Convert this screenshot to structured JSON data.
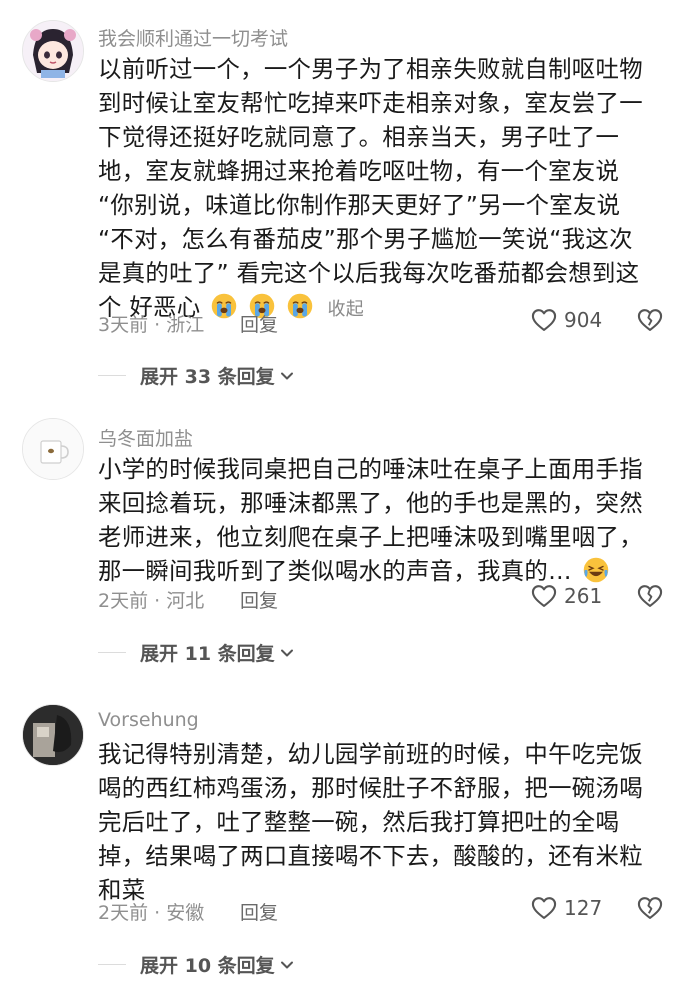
{
  "comments": [
    {
      "username": "我会顺利通过一切考试",
      "lines": [
        "以前听过一个，一个男子为了相亲失败就自制呕吐物",
        "到时候让室友帮忙吃掉来吓走相亲对象，室友尝了一",
        "下觉得还挺好吃就同意了。相亲当天，男子吐了一",
        "地，室友就蜂拥过来抢着吃呕吐物，有一个室友说",
        "“你别说，味道比你制作那天更好了”另一个室友说",
        "“不对，怎么有番茄皮”那个男子尴尬一笑说“我这次",
        "是真的吐了” 看完这个以后我每次吃番茄都会想到这",
        "个 好恶心"
      ],
      "emoji": [
        "loudly-crying-emoji",
        "loudly-crying-emoji",
        "loudly-crying-emoji"
      ],
      "fold_label": "收起",
      "time_location": "3天前 · 浙江",
      "reply_label": "回复",
      "likes": "904",
      "expand_label": "展开 33 条回复"
    },
    {
      "username": "乌冬面加盐",
      "lines": [
        "小学的时候我同桌把自己的唾沫吐在桌子上面用手指",
        "来回捻着玩，那唾沫都黑了，他的手也是黑的，突然",
        "老师进来，他立刻爬在桌子上把唾沫吸到嘴里咽了，",
        "那一瞬间我听到了类似喝水的声音，我真的…"
      ],
      "emoji": [
        "tears-of-joy-emoji"
      ],
      "time_location": "2天前 · 河北",
      "reply_label": "回复",
      "likes": "261",
      "expand_label": "展开 11 条回复"
    },
    {
      "username": "Vorsehung",
      "lines": [
        "我记得特别清楚，幼儿园学前班的时候，中午吃完饭",
        "喝的西红柿鸡蛋汤，那时候肚子不舒服，把一碗汤喝",
        "完后吐了，吐了整整一碗，然后我打算把吐的全喝",
        "掉，结果喝了两口直接喝不下去，酸酸的，还有米粒",
        "和菜"
      ],
      "time_location": "2天前 · 安徽",
      "reply_label": "回复",
      "likes": "127",
      "expand_label": "展开 10 条回复"
    }
  ],
  "colors": {
    "meta_gray": "#8f8f8f",
    "text": "#1a1a1a",
    "emoji_yellow": "#f9c23c",
    "tear_blue": "#5aa7e6"
  }
}
